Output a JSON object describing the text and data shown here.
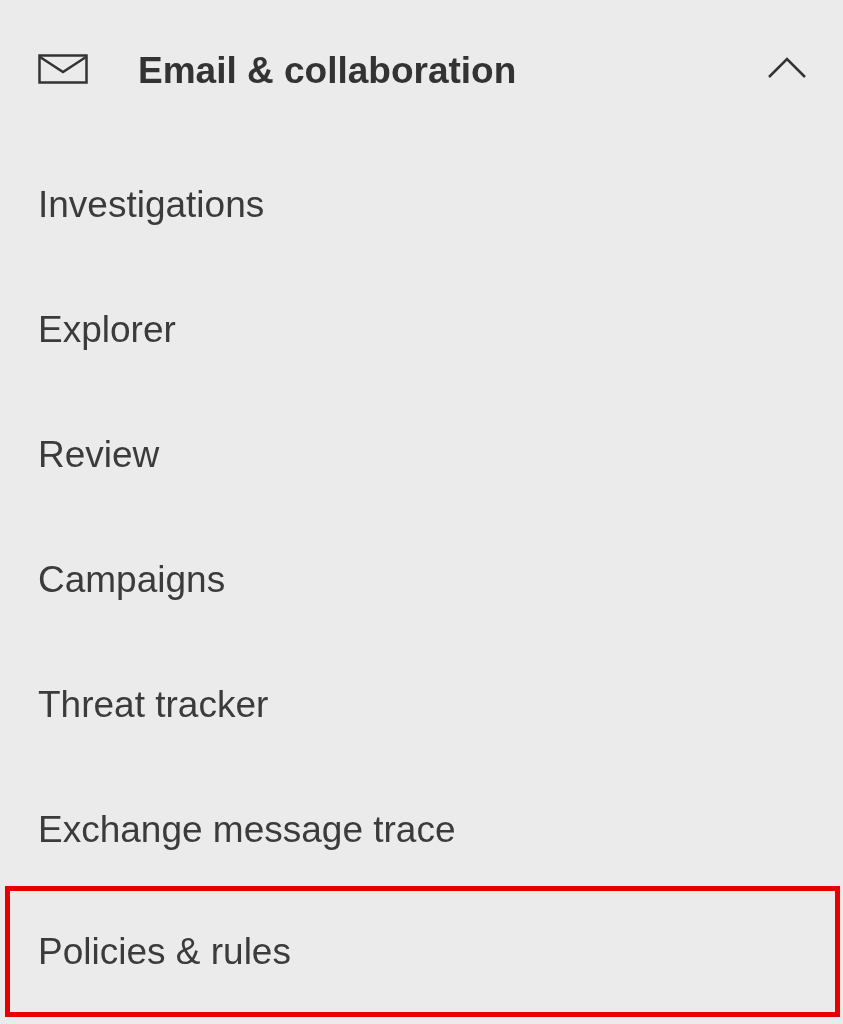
{
  "section": {
    "title": "Email & collaboration",
    "expanded": true
  },
  "items": [
    {
      "label": "Investigations",
      "highlighted": false
    },
    {
      "label": "Explorer",
      "highlighted": false
    },
    {
      "label": "Review",
      "highlighted": false
    },
    {
      "label": "Campaigns",
      "highlighted": false
    },
    {
      "label": "Threat tracker",
      "highlighted": false
    },
    {
      "label": "Exchange message trace",
      "highlighted": false
    },
    {
      "label": "Policies & rules",
      "highlighted": true
    }
  ]
}
